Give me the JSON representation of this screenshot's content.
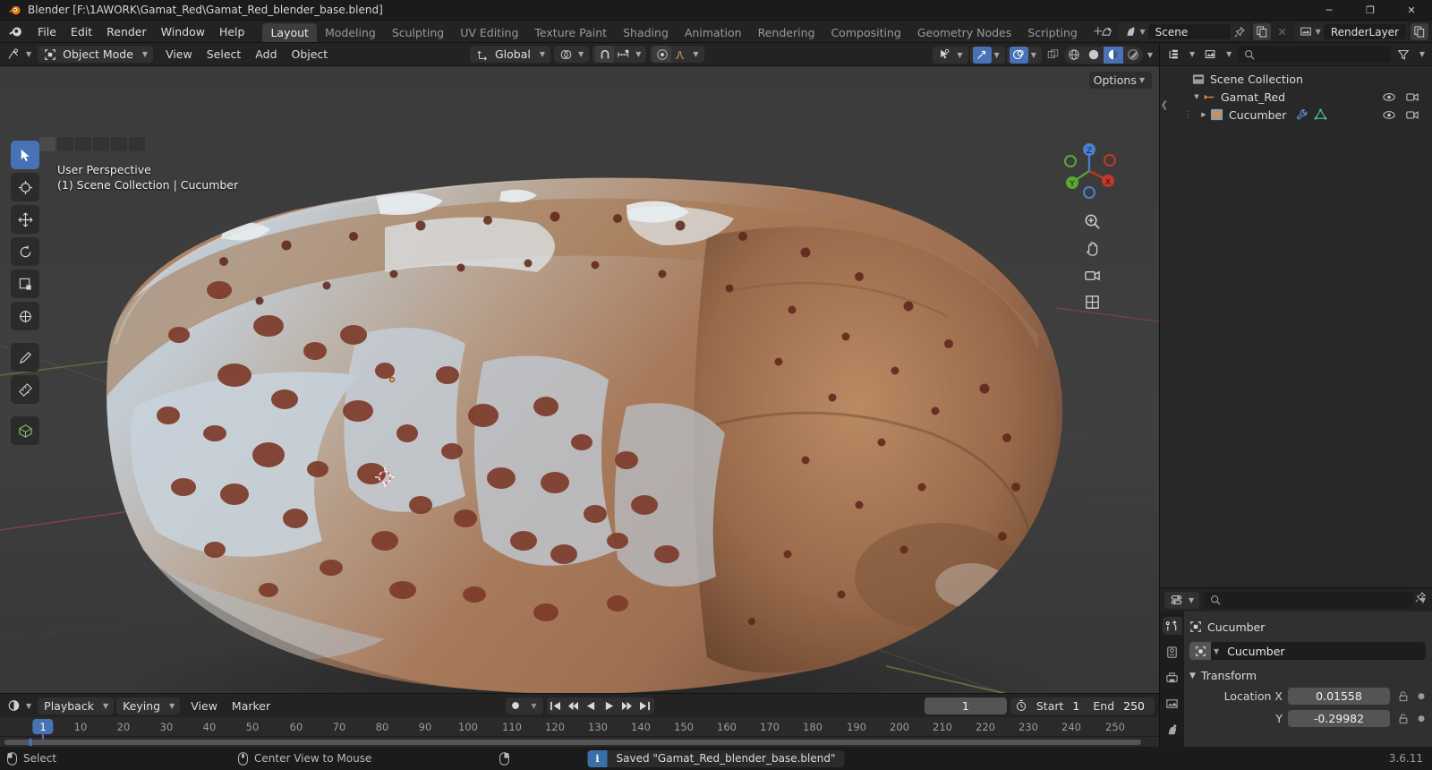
{
  "window": {
    "title": "Blender [F:\\1AWORK\\Gamat_Red\\Gamat_Red_blender_base.blend]",
    "minimize": "─",
    "maximize": "❐",
    "close": "✕"
  },
  "menubar": {
    "items": [
      "File",
      "Edit",
      "Render",
      "Window",
      "Help"
    ],
    "workspace_tabs": [
      {
        "label": "Layout",
        "active": true
      },
      {
        "label": "Modeling",
        "active": false
      },
      {
        "label": "Sculpting",
        "active": false
      },
      {
        "label": "UV Editing",
        "active": false
      },
      {
        "label": "Texture Paint",
        "active": false
      },
      {
        "label": "Shading",
        "active": false
      },
      {
        "label": "Animation",
        "active": false
      },
      {
        "label": "Rendering",
        "active": false
      },
      {
        "label": "Compositing",
        "active": false
      },
      {
        "label": "Geometry Nodes",
        "active": false
      },
      {
        "label": "Scripting",
        "active": false
      }
    ],
    "add_workspace": "+",
    "scene_name": "Scene",
    "viewlayer_name": "RenderLayer"
  },
  "viewport_header": {
    "mode": "Object Mode",
    "menus": [
      "View",
      "Select",
      "Add",
      "Object"
    ],
    "transform_orientation": "Global",
    "options_label": "Options"
  },
  "viewport": {
    "perspective": "User Perspective",
    "scene_info": "(1) Scene Collection | Cucumber",
    "gizmo_axes": [
      "X",
      "Y",
      "Z"
    ]
  },
  "outliner": {
    "search_placeholder": "",
    "rows": [
      {
        "label": "Scene Collection",
        "indent": 0,
        "icon": "collection-icon",
        "expander": "",
        "eye": false
      },
      {
        "label": "Gamat_Red",
        "indent": 1,
        "icon": "armature-icon",
        "expander": "▼",
        "eye": true
      },
      {
        "label": "Cucumber",
        "indent": 2,
        "icon": "mesh-data-icon",
        "expander": "▶",
        "eye": true
      }
    ]
  },
  "properties": {
    "breadcrumb": "Cucumber",
    "object_name": "Cucumber",
    "section_transform": "Transform",
    "fields": [
      {
        "label": "Location X",
        "value": "0.01558"
      },
      {
        "label": "Y",
        "value": "-0.29982"
      }
    ]
  },
  "timeline": {
    "menus": [
      "Playback",
      "Keying",
      "View",
      "Marker"
    ],
    "current_frame": "1",
    "start_label": "Start",
    "start_value": "1",
    "end_label": "End",
    "end_value": "250",
    "ticks": [
      "10",
      "20",
      "30",
      "40",
      "50",
      "60",
      "70",
      "80",
      "90",
      "100",
      "110",
      "120",
      "130",
      "140",
      "150",
      "160",
      "170",
      "180",
      "190",
      "200",
      "210",
      "220",
      "230",
      "240",
      "250"
    ],
    "playhead_label": "1"
  },
  "statusbar": {
    "items": [
      {
        "icon": "mouse-left-icon",
        "label": "Select"
      },
      {
        "icon": "mouse-middle-icon",
        "label": "Center View to Mouse"
      },
      {
        "icon": "mouse-right-icon",
        "label": ""
      }
    ],
    "report": "Saved \"Gamat_Red_blender_base.blend\"",
    "version": "3.6.11"
  },
  "colors": {
    "accent": "#4772b3",
    "panel": "#303030",
    "background": "#1d1d1d",
    "header": "#232323",
    "field": "#545454"
  }
}
